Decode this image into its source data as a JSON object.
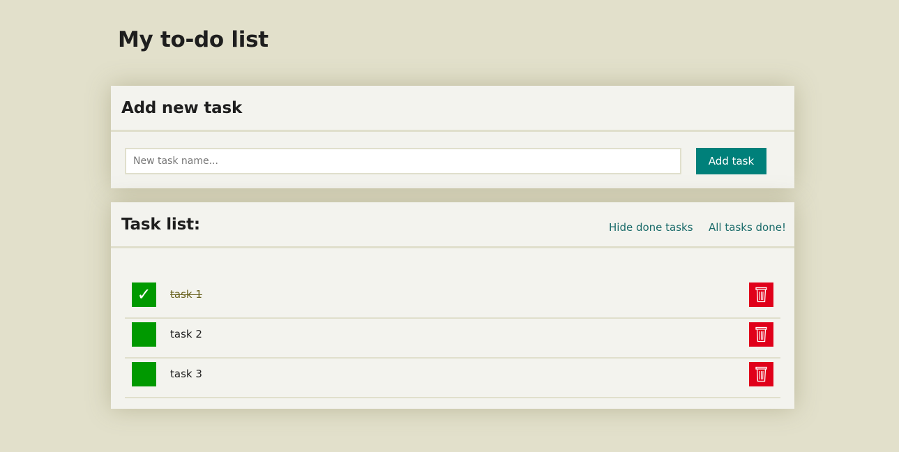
{
  "page": {
    "title": "My to-do list"
  },
  "add_section": {
    "title": "Add new task",
    "input_placeholder": "New task name...",
    "input_value": "",
    "button_label": "Add task"
  },
  "list_section": {
    "title": "Task list:",
    "hide_done_label": "Hide done tasks",
    "all_done_label": "All tasks done!",
    "tasks": [
      {
        "name": "task 1",
        "done": true,
        "check_glyph": "✓"
      },
      {
        "name": "task 2",
        "done": false,
        "check_glyph": ""
      },
      {
        "name": "task 3",
        "done": false,
        "check_glyph": ""
      }
    ]
  },
  "icons": {
    "check": "checkmark-icon",
    "delete": "trash-icon"
  },
  "colors": {
    "background": "#e2e0cb",
    "card": "#f3f3ee",
    "accent": "#00807a",
    "checkbox": "#009900",
    "delete": "#e0001a",
    "link": "#1a6b6a"
  }
}
